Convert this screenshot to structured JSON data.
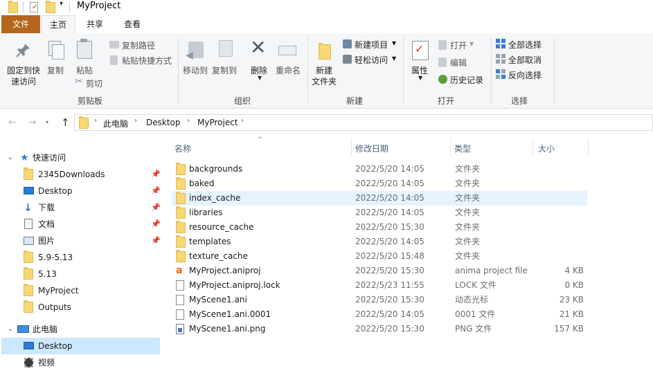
{
  "window": {
    "title": "MyProject"
  },
  "ribbon_tabs": [
    {
      "label": "文件",
      "active": false,
      "primary": true
    },
    {
      "label": "主页",
      "active": true
    },
    {
      "label": "共享",
      "active": false
    },
    {
      "label": "查看",
      "active": false
    }
  ],
  "ribbon": {
    "clipboard": {
      "pin_label_1": "固定到快",
      "pin_label_2": "速访问",
      "copy_label": "复制",
      "paste_label": "粘贴",
      "copy_path_label": "复制路径",
      "paste_shortcut_label": "粘贴快捷方式",
      "cut_label": "剪切",
      "group_label": "剪贴板"
    },
    "organize": {
      "move_to_label": "移动到",
      "copy_to_label": "复制到",
      "delete_label": "删除",
      "rename_label": "重命名",
      "group_label": "组织"
    },
    "new": {
      "new_folder_label_1": "新建",
      "new_folder_label_2": "文件夹",
      "new_item_label": "新建项目",
      "easy_access_label": "轻松访问",
      "group_label": "新建"
    },
    "open": {
      "properties_label": "属性",
      "open_label": "打开",
      "edit_label": "编辑",
      "history_label": "历史记录",
      "group_label": "打开"
    },
    "select": {
      "select_all_label": "全部选择",
      "select_none_label": "全部取消",
      "invert_label": "反向选择",
      "group_label": "选择"
    }
  },
  "address": {
    "crumbs": [
      "此电脑",
      "Desktop",
      "MyProject"
    ]
  },
  "columns": {
    "name": "名称",
    "modified": "修改日期",
    "type": "类型",
    "size": "大小"
  },
  "nav": {
    "quick_access": "快速访问",
    "items": [
      {
        "label": "2345Downloads",
        "icon": "folder-icon",
        "pinned": true
      },
      {
        "label": "Desktop",
        "icon": "desktop-icon",
        "pinned": true
      },
      {
        "label": "下载",
        "icon": "download-icon",
        "pinned": true
      },
      {
        "label": "文档",
        "icon": "document-icon",
        "pinned": true
      },
      {
        "label": "图片",
        "icon": "pictures-icon",
        "pinned": true
      },
      {
        "label": "5.9-5.13",
        "icon": "folder-icon",
        "pinned": false
      },
      {
        "label": "5.13",
        "icon": "folder-icon",
        "pinned": false
      },
      {
        "label": "MyProject",
        "icon": "folder-icon",
        "pinned": false
      },
      {
        "label": "Outputs",
        "icon": "folder-icon",
        "pinned": false
      }
    ],
    "this_pc": "此电脑",
    "pc_items": [
      {
        "label": "Desktop",
        "icon": "desktop-icon",
        "selected": true
      },
      {
        "label": "视频",
        "icon": "video-icon",
        "selected": false
      }
    ]
  },
  "files": [
    {
      "name": "backgrounds",
      "modified": "2022/5/20 14:05",
      "type": "文件夹",
      "size": "",
      "icon": "folder-icon"
    },
    {
      "name": "baked",
      "modified": "2022/5/20 14:05",
      "type": "文件夹",
      "size": "",
      "icon": "folder-icon"
    },
    {
      "name": "index_cache",
      "modified": "2022/5/20 14:05",
      "type": "文件夹",
      "size": "",
      "icon": "folder-icon",
      "selected": true
    },
    {
      "name": "libraries",
      "modified": "2022/5/20 14:05",
      "type": "文件夹",
      "size": "",
      "icon": "folder-icon"
    },
    {
      "name": "resource_cache",
      "modified": "2022/5/20 15:30",
      "type": "文件夹",
      "size": "",
      "icon": "folder-icon"
    },
    {
      "name": "templates",
      "modified": "2022/5/20 14:05",
      "type": "文件夹",
      "size": "",
      "icon": "folder-icon"
    },
    {
      "name": "texture_cache",
      "modified": "2022/5/20 15:48",
      "type": "文件夹",
      "size": "",
      "icon": "folder-icon"
    },
    {
      "name": "MyProject.aniproj",
      "modified": "2022/5/20 15:30",
      "type": "anima project file",
      "size": "4 KB",
      "icon": "anima-icon"
    },
    {
      "name": "MyProject.aniproj.lock",
      "modified": "2022/5/23 11:55",
      "type": "LOCK 文件",
      "size": "0 KB",
      "icon": "file-icon"
    },
    {
      "name": "MyScene1.ani",
      "modified": "2022/5/20 15:30",
      "type": "动态光标",
      "size": "23 KB",
      "icon": "file-icon"
    },
    {
      "name": "MyScene1.ani.0001",
      "modified": "2022/5/20 14:05",
      "type": "0001 文件",
      "size": "21 KB",
      "icon": "file-icon"
    },
    {
      "name": "MyScene1.ani.png",
      "modified": "2022/5/20 15:30",
      "type": "PNG 文件",
      "size": "157 KB",
      "icon": "png-file-icon"
    }
  ],
  "colors": {
    "file_tab": "#b5651d",
    "selection": "#e5f3ff",
    "nav_selected": "#cce8ff",
    "folder": "#f8d775"
  }
}
